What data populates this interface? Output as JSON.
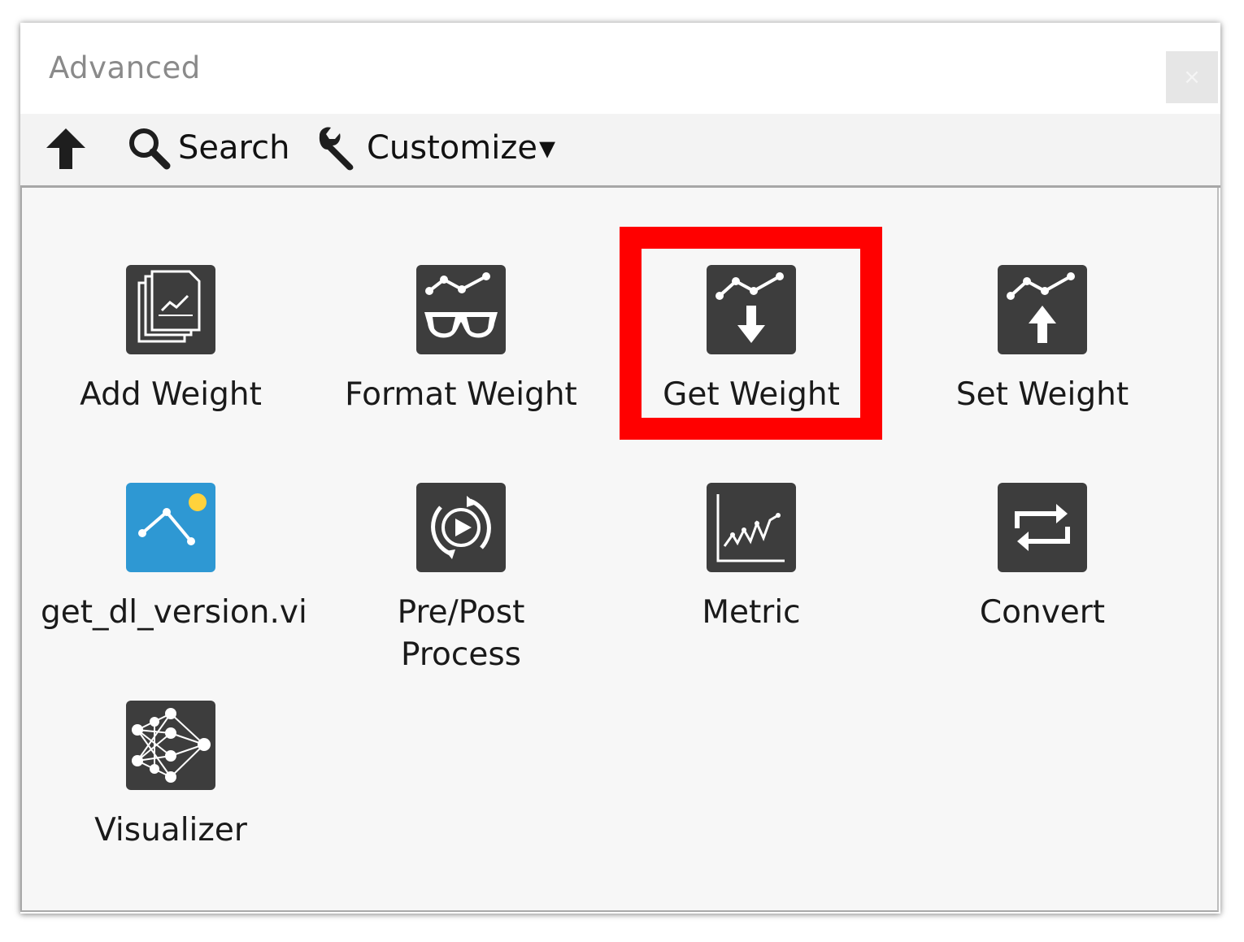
{
  "window": {
    "title": "Advanced",
    "close_glyph": "×"
  },
  "toolbar": {
    "up_icon": "up-arrow-icon",
    "search_label": "Search",
    "customize_label": "Customize",
    "customize_caret": "▾"
  },
  "palette_items": [
    {
      "label": "Add Weight",
      "icon": "stacked-pages-chart-icon"
    },
    {
      "label": "Format Weight",
      "icon": "glasses-chart-icon"
    },
    {
      "label": "Get Weight",
      "icon": "chart-down-arrow-icon",
      "highlighted": true
    },
    {
      "label": "Set Weight",
      "icon": "chart-up-arrow-icon"
    },
    {
      "label": "get_dl_version.vi",
      "icon": "blue-graph-icon"
    },
    {
      "label": "Pre/Post\nProcess",
      "icon": "cycle-play-icon"
    },
    {
      "label": "Metric",
      "icon": "line-graph-icon"
    },
    {
      "label": "Convert",
      "icon": "convert-arrows-icon"
    },
    {
      "label": "Visualizer",
      "icon": "neural-network-icon"
    }
  ],
  "colors": {
    "highlight": "#ff0000",
    "icon_dark": "#3d3d3d",
    "icon_blue": "#2e98d3"
  }
}
